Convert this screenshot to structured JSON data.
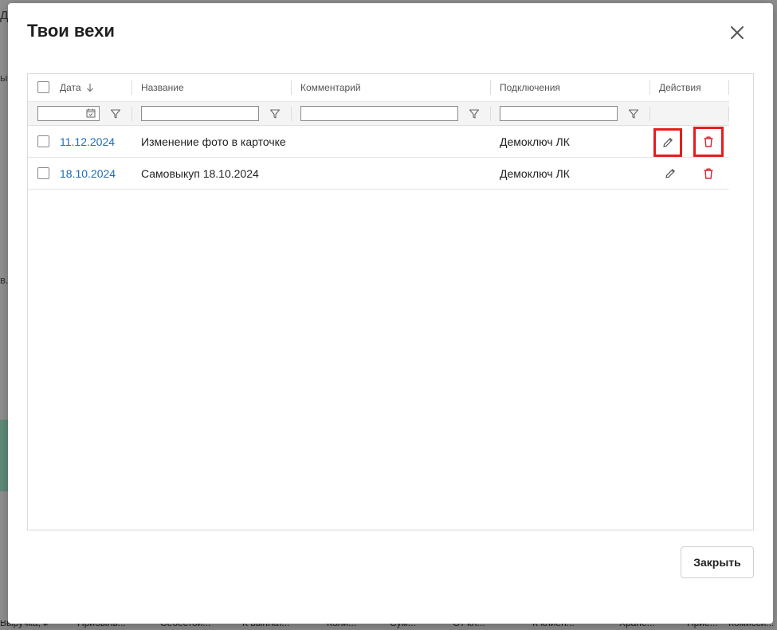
{
  "modal": {
    "title": "Твои вехи",
    "close_button_label": "Закрыть"
  },
  "grid": {
    "columns": [
      "Дата",
      "Название",
      "Комментарий",
      "Подключения",
      "Действия"
    ],
    "sort": {
      "column": "Дата",
      "direction": "descending"
    },
    "rows": [
      {
        "date": "11.12.2024",
        "name": "Изменение фото в карточке",
        "comment": "",
        "connection": "Демоключ ЛК"
      },
      {
        "date": "18.10.2024",
        "name": "Самовыкуп 18.10.2024",
        "comment": "",
        "connection": "Демоключ ЛК"
      }
    ],
    "filters": {
      "date": "",
      "name": "",
      "comment": "",
      "connection": ""
    }
  },
  "background": {
    "left_fragments": [
      "д",
      "ы",
      "в."
    ],
    "bottom_columns": [
      "Выручка, ₽",
      "Прибыль...",
      "Себестои...",
      "К выплат...",
      "Коли...",
      "Сум...",
      "От кл...",
      "К клиен...",
      "Хране...",
      "Прие...",
      "Комисси..."
    ]
  },
  "colors": {
    "link": "#1f6db5",
    "delete": "#d9262e",
    "highlight": "#e41e1e"
  },
  "icons": {
    "close": "close-icon",
    "sort": "arrow-down-icon",
    "calendar": "calendar-icon",
    "filter": "filter-icon",
    "edit": "pencil-icon",
    "delete": "trash-icon"
  }
}
